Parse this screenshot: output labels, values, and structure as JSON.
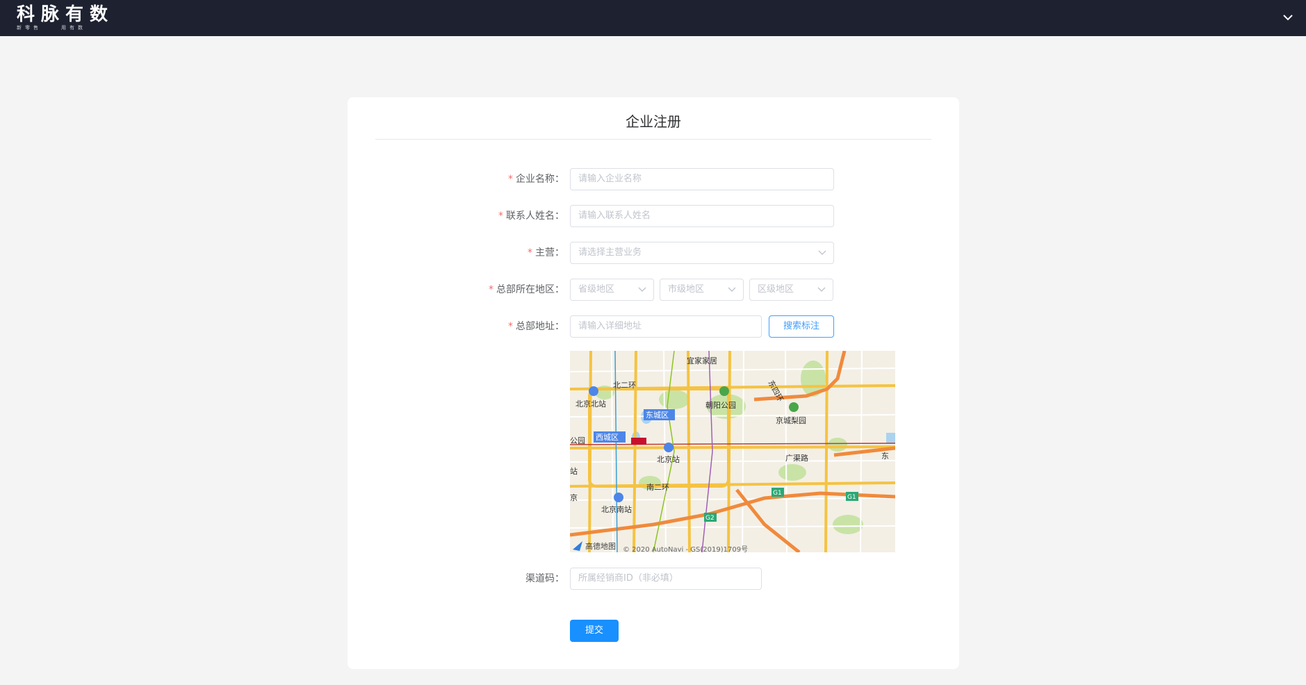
{
  "brand": {
    "name": "科脉有数",
    "slogan": [
      "新",
      "零",
      "售",
      "用",
      "有",
      "数"
    ]
  },
  "header": {
    "menu_icon": "chevron-down-icon"
  },
  "form": {
    "title": "企业注册",
    "company_name": {
      "label": "企业名称：",
      "placeholder": "请输入企业名称",
      "required": true
    },
    "contact_name": {
      "label": "联系人姓名：",
      "placeholder": "请输入联系人姓名",
      "required": true
    },
    "business": {
      "label": "主营：",
      "placeholder": "请选择主营业务",
      "required": true
    },
    "region": {
      "label": "总部所在地区：",
      "required": true,
      "province_placeholder": "省级地区",
      "city_placeholder": "市级地区",
      "district_placeholder": "区级地区"
    },
    "address": {
      "label": "总部地址：",
      "placeholder": "请输入详细地址",
      "required": true,
      "search_button": "搜索标注"
    },
    "channel_code": {
      "label": "渠道码：",
      "placeholder": "所属经销商ID（非必填）",
      "required": false
    },
    "submit_label": "提交"
  },
  "map": {
    "places": [
      "宜家家居",
      "北二环",
      "北京北站",
      "东城区",
      "朝阳公园",
      "京城梨园",
      "西城区",
      "北京站",
      "广渠路",
      "南二环",
      "北京南站",
      "东四环",
      "公园",
      "站",
      "京",
      "东"
    ],
    "road_badges": [
      "G1",
      "G1",
      "G2"
    ],
    "attribution": "高德地图",
    "copyright": "© 2020 AutoNavi - GS(2019)1709号",
    "colors": {
      "background": "#f3efe5",
      "major_road": "#f5a623",
      "expressway": "#f08a3c",
      "green": "#c9e3a6",
      "water": "#a9d3f0"
    }
  },
  "colors": {
    "accent": "#1890ff",
    "required": "#f56c6c",
    "topbar": "#1e2130"
  }
}
